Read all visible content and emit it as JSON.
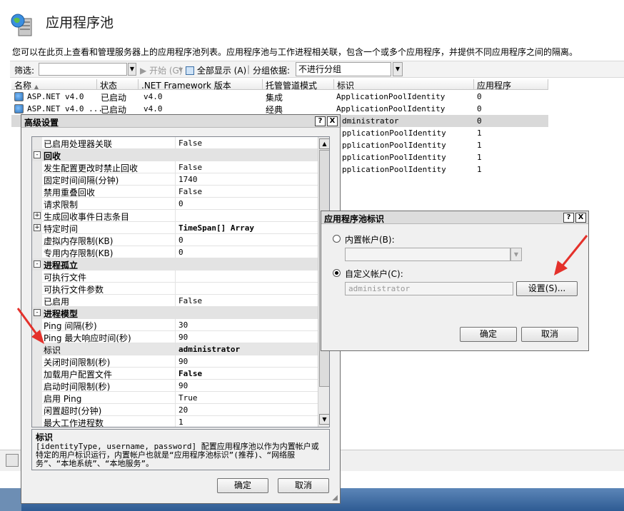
{
  "header": {
    "title": "应用程序池",
    "description": "您可以在此页上查看和管理服务器上的应用程序池列表。应用程序池与工作进程相关联，包含一个或多个应用程序，并提供不同应用程序之间的隔离。"
  },
  "toolbar": {
    "filter_label": "筛选:",
    "start_label": "开始 (G)",
    "show_all_label": "全部显示 (A)",
    "group_by_label": "分组依据:",
    "group_by_value": "不进行分组"
  },
  "list": {
    "columns": [
      "名称",
      "状态",
      ".NET Framework 版本",
      "托管管道模式",
      "标识",
      "应用程序"
    ],
    "rows": [
      {
        "name": "ASP.NET v4.0",
        "status": "已启动",
        "version": "v4.0",
        "mode": "集成",
        "identity": "ApplicationPoolIdentity",
        "apps": "0"
      },
      {
        "name": "ASP.NET v4.0 ...",
        "status": "已启动",
        "version": "v4.0",
        "mode": "经典",
        "identity": "ApplicationPoolIdentity",
        "apps": "0"
      },
      {
        "name": "",
        "status": "",
        "version": "",
        "mode": "",
        "identity": "dministrator",
        "apps": "0"
      },
      {
        "name": "",
        "status": "",
        "version": "",
        "mode": "",
        "identity": "pplicationPoolIdentity",
        "apps": "1"
      },
      {
        "name": "",
        "status": "",
        "version": "",
        "mode": "",
        "identity": "pplicationPoolIdentity",
        "apps": "1"
      },
      {
        "name": "",
        "status": "",
        "version": "",
        "mode": "",
        "identity": "pplicationPoolIdentity",
        "apps": "1"
      },
      {
        "name": "",
        "status": "",
        "version": "",
        "mode": "",
        "identity": "pplicationPoolIdentity",
        "apps": "1"
      }
    ]
  },
  "advanced": {
    "title": "高级设置",
    "help_btn": "?",
    "close_btn": "X",
    "rows": [
      {
        "name": "已启用处理器关联",
        "value": "False"
      },
      {
        "name": "回收",
        "value": ""
      },
      {
        "name": "发生配置更改时禁止回收",
        "value": "False"
      },
      {
        "name": "固定时间间隔(分钟)",
        "value": "1740"
      },
      {
        "name": "禁用重叠回收",
        "value": "False"
      },
      {
        "name": "请求限制",
        "value": "0"
      },
      {
        "name": "生成回收事件日志条目",
        "value": ""
      },
      {
        "name": "特定时间",
        "value": "TimeSpan[] Array"
      },
      {
        "name": "虚拟内存限制(KB)",
        "value": "0"
      },
      {
        "name": "专用内存限制(KB)",
        "value": "0"
      },
      {
        "name": "进程孤立",
        "value": ""
      },
      {
        "name": "可执行文件",
        "value": ""
      },
      {
        "name": "可执行文件参数",
        "value": ""
      },
      {
        "name": "已启用",
        "value": "False"
      },
      {
        "name": "进程模型",
        "value": ""
      },
      {
        "name": "Ping 间隔(秒)",
        "value": "30"
      },
      {
        "name": "Ping 最大响应时间(秒)",
        "value": "90"
      },
      {
        "name": "标识",
        "value": "administrator"
      },
      {
        "name": "关闭时间限制(秒)",
        "value": "90"
      },
      {
        "name": "加载用户配置文件",
        "value": "False"
      },
      {
        "name": "启动时间限制(秒)",
        "value": "90"
      },
      {
        "name": "启用 Ping",
        "value": "True"
      },
      {
        "name": "闲置超时(分钟)",
        "value": "20"
      },
      {
        "name": "最大工作进程数",
        "value": "1"
      }
    ],
    "expander_plus": "+",
    "expander_minus": "-",
    "scroll_up": "▲",
    "scroll_down": "▼",
    "desc_title": "标识",
    "desc_text": "[identityType, username, password] 配置应用程序池以作为内置帐户或特定的用户标识运行，内置帐户也就是“应用程序池标识”(推荐)、“网络服务”、“本地系统”、“本地服务”。",
    "ok": "确定",
    "cancel": "取消"
  },
  "identity_dialog": {
    "title": "应用程序池标识",
    "help_btn": "?",
    "close_btn": "X",
    "builtin_label": "内置帐户(B):",
    "builtin_value": "",
    "custom_label": "自定义帐户(C):",
    "custom_value": "administrator",
    "set_button": "设置(S)...",
    "ok": "确定",
    "cancel": "取消"
  },
  "colors": {
    "arrow": "#e4312b",
    "taskbar": "#2e5b93"
  }
}
